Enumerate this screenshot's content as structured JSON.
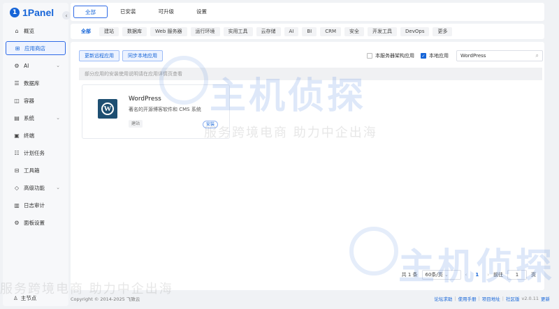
{
  "brand": {
    "name": "1Panel",
    "mark": "1"
  },
  "sidebar": {
    "items": [
      {
        "label": "概览",
        "icon": "home-icon",
        "glyph": "⌂"
      },
      {
        "label": "应用商店",
        "icon": "apps-grid-icon",
        "glyph": "⊞",
        "active": true
      },
      {
        "label": "AI",
        "icon": "robot-icon",
        "glyph": "⚙",
        "chevron": "⌄"
      },
      {
        "label": "数据库",
        "icon": "database-icon",
        "glyph": "☰"
      },
      {
        "label": "容器",
        "icon": "container-icon",
        "glyph": "◫"
      },
      {
        "label": "系统",
        "icon": "system-icon",
        "glyph": "▤",
        "chevron": "⌄"
      },
      {
        "label": "终端",
        "icon": "terminal-icon",
        "glyph": "▣"
      },
      {
        "label": "计划任务",
        "icon": "schedule-icon",
        "glyph": "☷"
      },
      {
        "label": "工具箱",
        "icon": "toolbox-icon",
        "glyph": "⊟"
      },
      {
        "label": "高级功能",
        "icon": "diamond-icon",
        "glyph": "◇",
        "chevron": "⌄"
      },
      {
        "label": "日志审计",
        "icon": "log-icon",
        "glyph": "▥"
      },
      {
        "label": "面板设置",
        "icon": "gear-icon",
        "glyph": "⚙"
      }
    ],
    "footer_label": "主节点"
  },
  "tabs": [
    "全部",
    "已安装",
    "可升级",
    "设置"
  ],
  "categories": [
    "全部",
    "建站",
    "数据库",
    "Web 服务器",
    "运行环境",
    "实用工具",
    "云存储",
    "AI",
    "BI",
    "CRM",
    "安全",
    "开发工具",
    "DevOps",
    "更多"
  ],
  "toolbar": {
    "sync_remote": "更新远程应用",
    "sync_local": "同步本地应用",
    "arch_filter": "本服务器架构应用",
    "local_apps": "本地应用",
    "search_value": "WordPress"
  },
  "notice": "部分应用的安装使用说明请在应用详情页查看",
  "app": {
    "name": "WordPress",
    "desc": "著名的开源博客软件和 CMS 系统",
    "tag": "建站",
    "install": "安装"
  },
  "pagination": {
    "total": "共 1 条",
    "page_size": "60条/页",
    "current": "1",
    "goto_label": "前往",
    "goto_value": "1",
    "page_suffix": "页"
  },
  "footer": {
    "copyright": "Copyright © 2014-2025 飞致云",
    "links": [
      "论坛求助",
      "使用手册",
      "项目地址",
      "社区版"
    ],
    "version": "v2.0.11",
    "update": "更新"
  },
  "watermark": {
    "big": "主机侦探",
    "sub": "服务跨境电商 助力中企出海"
  },
  "colors": {
    "accent": "#1665d8",
    "bg": "#f0f2f5"
  }
}
